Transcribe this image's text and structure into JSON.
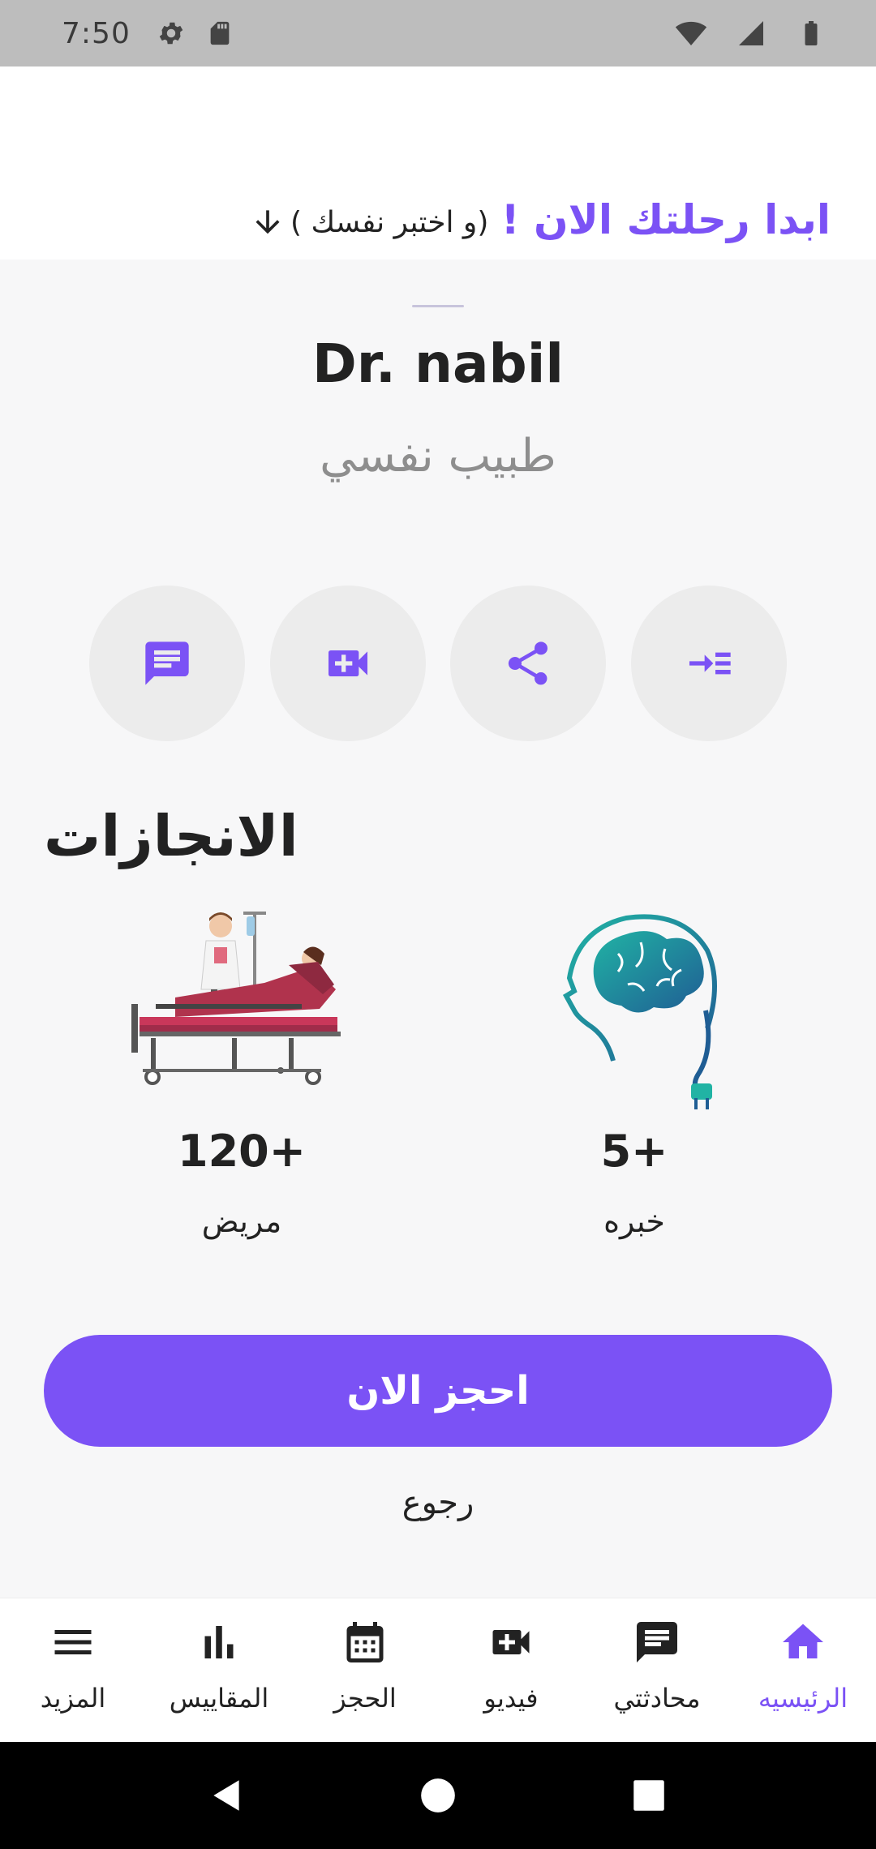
{
  "status_bar": {
    "time": "7:50",
    "left_icons": [
      "gear-icon",
      "sd-card-icon"
    ],
    "right_icons": [
      "wifi-icon",
      "signal-icon",
      "battery-icon"
    ]
  },
  "header": {
    "journey_text": "ابدا رحلتك الان !",
    "test_yourself_text": "( و اختبر نفسك)",
    "accent_color": "#7b52f5"
  },
  "profile": {
    "name": "Dr. nabil",
    "title": "طبيب نفسي"
  },
  "actions": [
    {
      "name": "chat",
      "icon": "chat-icon"
    },
    {
      "name": "video",
      "icon": "video-call-icon"
    },
    {
      "name": "share",
      "icon": "share-icon"
    },
    {
      "name": "enter",
      "icon": "indent-icon"
    }
  ],
  "achievements": {
    "title": "الانجازات",
    "stats": [
      {
        "value": "120+",
        "label": "مريض"
      },
      {
        "value": "5+",
        "label": "خبره"
      }
    ]
  },
  "book_button": {
    "label": "احجز الان"
  },
  "back_link": {
    "label": "رجوع"
  },
  "bottom_nav": {
    "items": [
      {
        "label": "المزيد",
        "icon": "menu-icon"
      },
      {
        "label": "المقاييس",
        "icon": "bar-chart-icon"
      },
      {
        "label": "الحجز",
        "icon": "calendar-icon"
      },
      {
        "label": "فيديو",
        "icon": "video-call-icon"
      },
      {
        "label": "محادثتي",
        "icon": "chat-icon"
      },
      {
        "label": "الرئيسيه",
        "icon": "home-icon",
        "active": true
      }
    ]
  },
  "system_nav": [
    "back-icon",
    "home-circle-icon",
    "recents-icon"
  ]
}
